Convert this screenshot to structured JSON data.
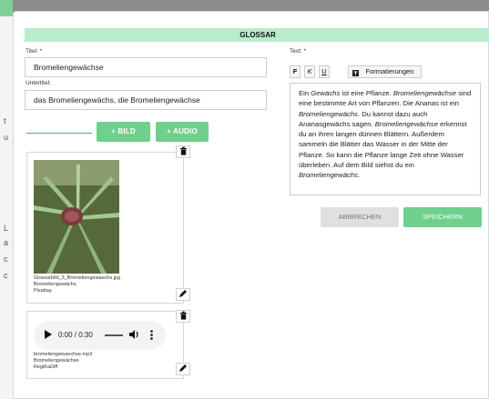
{
  "background": {
    "letters": [
      "t",
      "u",
      "L",
      "a",
      "c",
      "c"
    ]
  },
  "dialog": {
    "title": "GLOSSAR",
    "title_label": "Titel: *",
    "title_value": "Bromeliengewächse",
    "subtitle_label": "Untertitel:",
    "subtitle_value": "das Bromeliengewächs, die Bromeliengewächse",
    "text_label": "Text: *",
    "add_image_label": "+ BILD",
    "add_audio_label": "+ AUDIO",
    "toolbar": {
      "bold_label": "F",
      "italic_label": "K",
      "underline_label": "U",
      "formatting_label": "Formatierungen"
    },
    "text_content": [
      {
        "t": "Ein ",
        "i": false
      },
      {
        "t": "Gewächs",
        "i": true
      },
      {
        "t": " ist eine Pflanze. ",
        "i": false
      },
      {
        "t": "Bromeliengewächse",
        "i": true
      },
      {
        "t": " sind eine bestimmte Art von Pflanzen. Die Ananas ist ein ",
        "i": false
      },
      {
        "t": "Bromeliengewächs",
        "i": true
      },
      {
        "t": ". Du kannst dazu auch Ananasgewächs sagen. ",
        "i": false
      },
      {
        "t": "Bromeliengewächse",
        "i": true
      },
      {
        "t": " erkennst du an ihren langen dünnen Blättern. Außerdem sammeln die Blätter das Wasser in der Mitte der Pflanze. So kann die Pflanze lange Zeit ohne Wasser überleben. Auf dem Bild siehst du ein ",
        "i": false
      },
      {
        "t": "Bromeliengewächs",
        "i": true
      },
      {
        "t": ".",
        "i": false
      }
    ],
    "image_card": {
      "filename": "Glossarbild_3_Bromeliengewaechs.jpg",
      "caption": "Bromeliengewächs.",
      "credit": "Pixabay."
    },
    "audio_card": {
      "time": "0:00 / 0:30",
      "filename": "bromeliengewaechse.mp3",
      "caption": "Bromeliengewächse",
      "credit": "RegiKaDiff"
    },
    "cancel_label": "ABBRECHEN",
    "save_label": "SPEICHERN",
    "colors": {
      "accent": "#6fcf8c",
      "header": "#b9ebcd"
    }
  }
}
